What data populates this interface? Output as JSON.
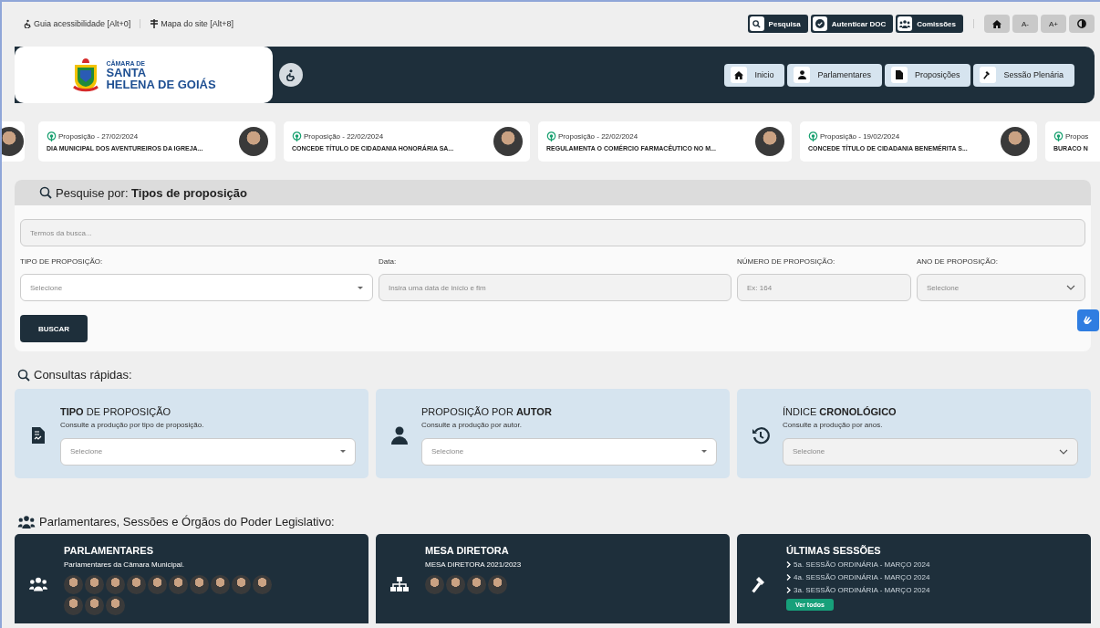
{
  "top_links": [
    {
      "kind": "accessibility",
      "label": "Guia acessibilidade [Alt+0]"
    },
    {
      "kind": "sitemap",
      "label": "Mapa do site [Alt+8]"
    }
  ],
  "quick_buttons": [
    {
      "kind": "search",
      "label": "Pesquisa"
    },
    {
      "kind": "check",
      "label": "Autenticar DOC"
    },
    {
      "kind": "group",
      "label": "Comissões"
    }
  ],
  "tool_buttons": [
    {
      "kind": "home"
    },
    {
      "kind": "text",
      "label": "A-"
    },
    {
      "kind": "text",
      "label": "A+"
    },
    {
      "kind": "contrast"
    }
  ],
  "logo": {
    "small": "CÂMARA DE",
    "line1": "SANTA",
    "line2": "HELENA DE GOIÁS"
  },
  "nav": [
    {
      "kind": "home",
      "label": "Inicio"
    },
    {
      "kind": "person",
      "label": "Parlamentares"
    },
    {
      "kind": "file",
      "label": "Proposições"
    },
    {
      "kind": "gavel",
      "label": "Sessão Plenária"
    }
  ],
  "carousel": [
    {
      "date": "Proposição - 27/02/2024",
      "title": "DIA MUNICIPAL DOS AVENTUREIROS DA IGREJA...",
      "partial": false
    },
    {
      "date": "Proposição - 22/02/2024",
      "title": "CONCEDE TÍTULO DE CIDADANIA HONORÁRIA SA...",
      "partial": false
    },
    {
      "date": "Proposição - 22/02/2024",
      "title": "REGULAMENTA O COMÉRCIO FARMACÊUTICO NO M...",
      "partial": false
    },
    {
      "date": "Proposição - 19/02/2024",
      "title": "CONCEDE TÍTULO DE CIDADANIA BENEMÉRITA S...",
      "partial": false
    },
    {
      "date": "Propos",
      "title": "BURACO N",
      "partial": true
    }
  ],
  "search": {
    "title_prefix": "Pesquise por:",
    "title_bold": "Tipos de proposição",
    "placeholder": "Termos da busca...",
    "fields": [
      {
        "kind": "select",
        "label": "TIPO DE PROPOSIÇÃO:",
        "placeholder": "Selecione"
      },
      {
        "kind": "text",
        "label": "Data:",
        "placeholder": "Insira uma data de início e fim"
      },
      {
        "kind": "text",
        "label": "NÚMERO DE PROPOSIÇÃO:",
        "placeholder": "Ex: 164"
      },
      {
        "kind": "dropdown",
        "label": "ANO DE PROPOSIÇÃO:",
        "placeholder": "Selecione"
      }
    ],
    "button": "BUSCAR"
  },
  "quick": {
    "title": "Consultas rápidas:",
    "cards": [
      {
        "kind": "file",
        "heading": "**TIPO** DE PROPOSIÇÃO",
        "text": "Consulte a produção por tipo de proposição.",
        "select": {
          "kind": "select",
          "placeholder": "Selecione"
        }
      },
      {
        "kind": "person",
        "heading": "PROPOSIÇÃO POR **AUTOR**",
        "text": "Consulte a produção por autor.",
        "select": {
          "kind": "select",
          "placeholder": "Selecione"
        }
      },
      {
        "kind": "history",
        "heading": "ÍNDICE **CRONOLÓGICO**",
        "text": "Consulte a produção por anos.",
        "select": {
          "kind": "dropdown",
          "placeholder": "Selecione"
        }
      }
    ]
  },
  "legislative": {
    "title": "Parlamentares, Sessões e Órgãos do Poder Legislativo:",
    "cards": [
      {
        "kind": "group",
        "heading": "PARLAMENTARES",
        "text": "Parlamentares da Câmara Municipal.",
        "photos": true
      },
      {
        "kind": "org",
        "heading": "MESA DIRETORA",
        "text": "MESA DIRETORA 2021/2023",
        "photos": true
      },
      {
        "kind": "gavel",
        "heading": "ÚLTIMAS SESSÕES",
        "sessions": [
          "5a. SESSÃO ORDINÁRIA - MARÇO 2024",
          "4a. SESSÃO ORDINÁRIA - MARÇO 2024",
          "3a. SESSÃO ORDINÁRIA - MARÇO 2024"
        ],
        "button": "Ver todos"
      }
    ]
  }
}
